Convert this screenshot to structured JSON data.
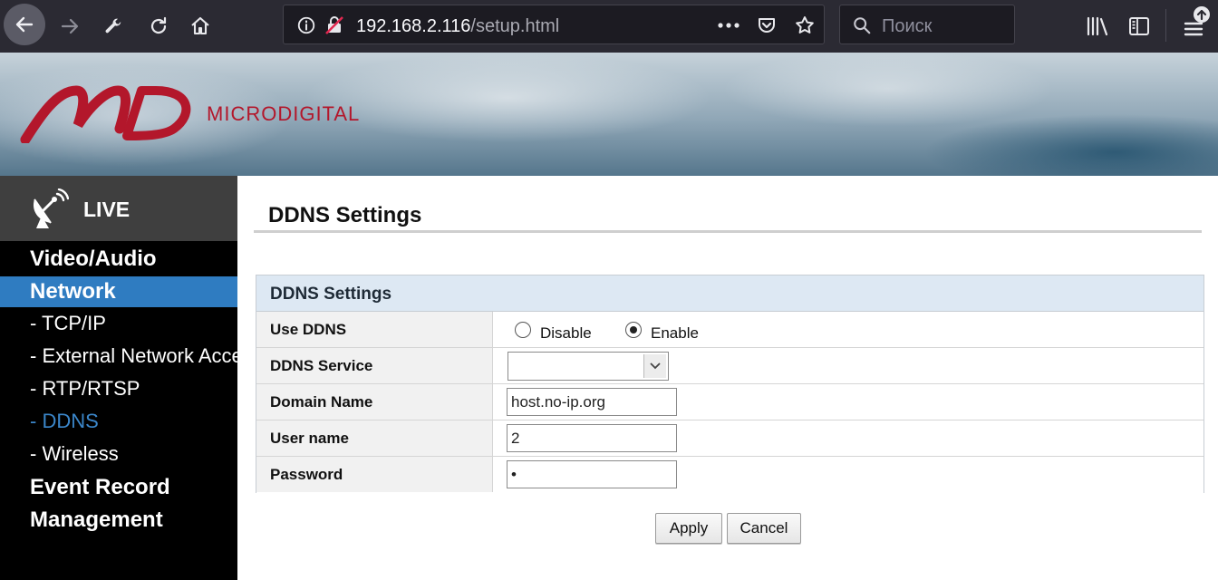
{
  "browser": {
    "url_host": "192.168.2.116",
    "url_path": "/setup.html",
    "search_placeholder": "Поиск"
  },
  "banner": {
    "logo_text": "MICRODIGITAL",
    "brand_color": "#b3172b"
  },
  "sidebar": {
    "live_label": "LIVE",
    "items": [
      {
        "label": "Video/Audio",
        "level": "main"
      },
      {
        "label": "Network",
        "level": "main",
        "active": true
      },
      {
        "label": "- TCP/IP",
        "level": "sub"
      },
      {
        "label": "- External Network Access",
        "level": "sub"
      },
      {
        "label": "- RTP/RTSP",
        "level": "sub"
      },
      {
        "label": "- DDNS",
        "level": "sub",
        "active": true
      },
      {
        "label": "- Wireless",
        "level": "sub"
      },
      {
        "label": "Event Record",
        "level": "main"
      },
      {
        "label": "Management",
        "level": "main"
      }
    ],
    "accent_color": "#2f7cc1"
  },
  "page": {
    "title": "DDNS Settings",
    "panel_title": "DDNS Settings",
    "fields": {
      "use_ddns": {
        "label": "Use DDNS",
        "options": [
          "Disable",
          "Enable"
        ],
        "selected": "Enable"
      },
      "ddns_service": {
        "label": "DDNS Service",
        "value": ""
      },
      "domain_name": {
        "label": "Domain Name",
        "value": "host.no-ip.org"
      },
      "user_name": {
        "label": "User name",
        "value": "2"
      },
      "password": {
        "label": "Password",
        "value": "•"
      }
    },
    "buttons": {
      "apply": "Apply",
      "cancel": "Cancel"
    }
  }
}
